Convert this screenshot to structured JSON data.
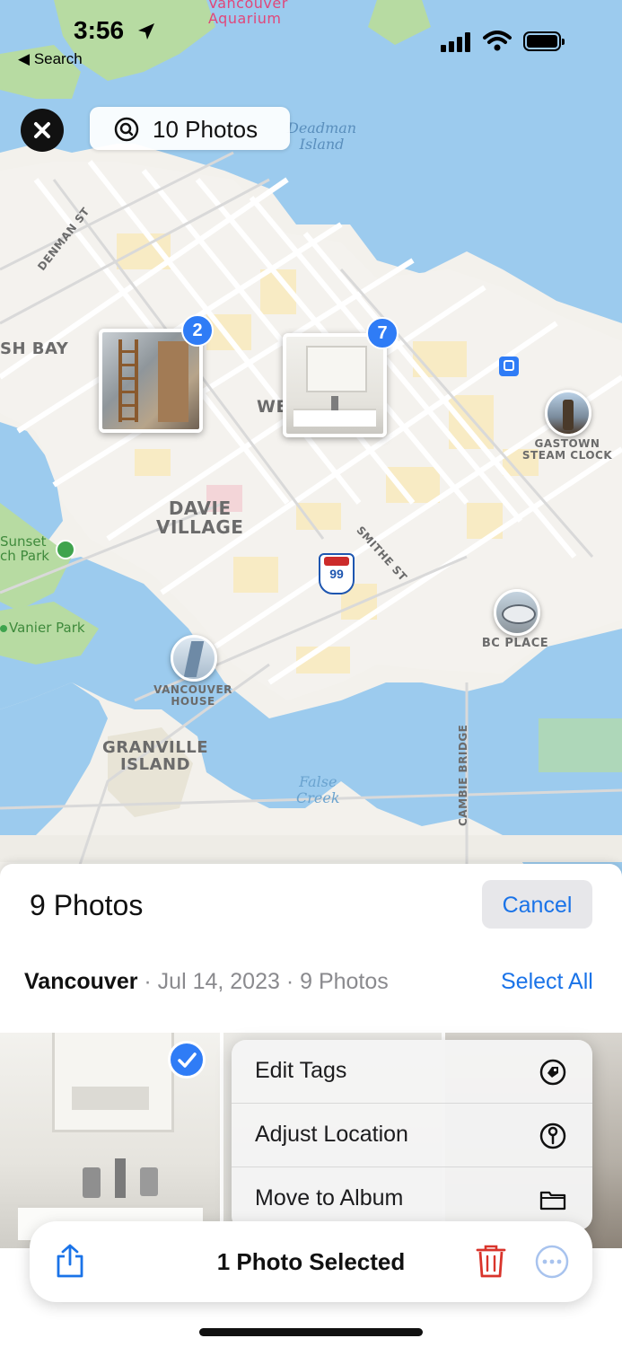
{
  "status_bar": {
    "time": "3:56",
    "back_label": "Search"
  },
  "map_header": {
    "photos_label": "10 Photos"
  },
  "map_labels": {
    "aquarium_line1": "Vancouver",
    "aquarium_line2": "Aquarium",
    "deadman_line1": "Deadman",
    "deadman_line2": "Island",
    "denman": "DENMAN ST",
    "bay": "SH BAY",
    "west_end": "WE",
    "davie_line1": "DAVIE",
    "davie_line2": "VILLAGE",
    "sunset_line1": "Sunset",
    "sunset_line2": "ch Park",
    "vanier": "Vanier Park",
    "smithe": "SMITHE ST",
    "highway": "99",
    "gastown_line1": "GASTOWN",
    "gastown_line2": "STEAM CLOCK",
    "bc_place": "BC PLACE",
    "vanhouse_line1": "VANCOUVER",
    "vanhouse_line2": "HOUSE",
    "granville_line1": "GRANVILLE",
    "granville_line2": "ISLAND",
    "false_creek_line1": "False",
    "false_creek_line2": "Creek",
    "cambie": "CAMBIE BRIDGE"
  },
  "clusters": [
    {
      "count": "2"
    },
    {
      "count": "7"
    }
  ],
  "sheet": {
    "title": "9 Photos",
    "cancel_label": "Cancel",
    "location": "Vancouver",
    "meta": " · Jul 14, 2023 · 9 Photos",
    "select_all_label": "Select All"
  },
  "context_menu": {
    "items": [
      {
        "label": "Edit Tags",
        "icon": "tag-icon"
      },
      {
        "label": "Adjust Location",
        "icon": "location-pin-icon"
      },
      {
        "label": "Move to Album",
        "icon": "folder-icon"
      }
    ]
  },
  "toolbar": {
    "selected_label": "1 Photo Selected"
  },
  "colors": {
    "accent": "#2f7cf6",
    "system_blue": "#1a73e8",
    "delete_red": "#d9342b",
    "water": "#9ccbee",
    "park": "#b7dba2"
  }
}
